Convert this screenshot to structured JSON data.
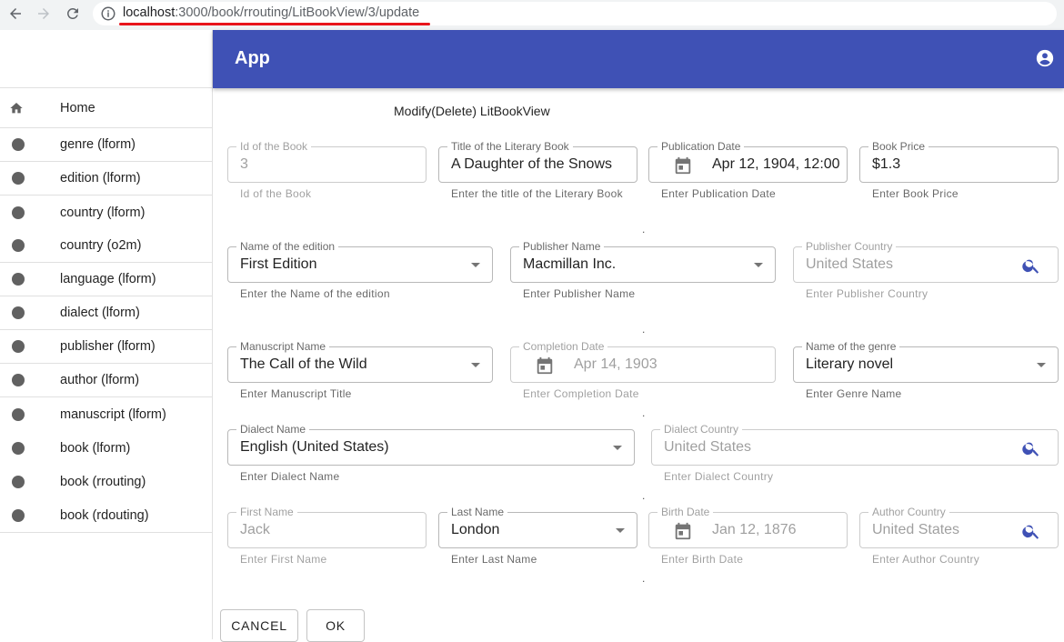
{
  "browser": {
    "url_host": "localhost",
    "url_path": ":3000/book/rrouting/LitBookView/3/update"
  },
  "app": {
    "title": "App"
  },
  "sidebar": {
    "items": [
      {
        "label": "Home",
        "icon": "home-icon"
      },
      {
        "label": "genre (lform)",
        "icon": "dot-icon"
      },
      {
        "label": "edition (lform)",
        "icon": "dot-icon"
      },
      {
        "label": "country (lform)",
        "icon": "dot-icon"
      },
      {
        "label": "country (o2m)",
        "icon": "dot-icon"
      },
      {
        "label": "language (lform)",
        "icon": "dot-icon"
      },
      {
        "label": "dialect (lform)",
        "icon": "dot-icon"
      },
      {
        "label": "publisher (lform)",
        "icon": "dot-icon"
      },
      {
        "label": "author (lform)",
        "icon": "dot-icon"
      },
      {
        "label": "manuscript (lform)",
        "icon": "dot-icon"
      },
      {
        "label": "book (lform)",
        "icon": "dot-icon"
      },
      {
        "label": "book (rrouting)",
        "icon": "dot-icon"
      },
      {
        "label": "book (rdouting)",
        "icon": "dot-icon"
      }
    ]
  },
  "form": {
    "title": "Modify(Delete) LitBookView",
    "separator": ".",
    "fields": {
      "id": {
        "label": "Id of the Book",
        "value": "3",
        "helper": "Id of the Book"
      },
      "title": {
        "label": "Title of the Literary Book",
        "value": "A Daughter of the Snows",
        "helper": "Enter the title of the Literary Book"
      },
      "pub_date": {
        "label": "Publication Date",
        "value": "Apr 12, 1904, 12:00",
        "helper": "Enter Publication Date"
      },
      "price": {
        "label": "Book Price",
        "value": "$1.3",
        "helper": "Enter Book Price"
      },
      "edition": {
        "label": "Name of the edition",
        "value": "First Edition",
        "helper": "Enter the Name of the edition"
      },
      "publisher": {
        "label": "Publisher Name",
        "value": "Macmillan Inc.",
        "helper": "Enter Publisher Name"
      },
      "pub_country": {
        "label": "Publisher Country",
        "value": "United States",
        "helper": "Enter Publisher Country"
      },
      "manuscript": {
        "label": "Manuscript Name",
        "value": "The Call of the Wild",
        "helper": "Enter Manuscript Title"
      },
      "completion": {
        "label": "Completion Date",
        "value": "Apr 14, 1903",
        "helper": "Enter Completion Date"
      },
      "genre": {
        "label": "Name of the genre",
        "value": "Literary novel",
        "helper": "Enter Genre Name"
      },
      "dialect": {
        "label": "Dialect Name",
        "value": "English (United States)",
        "helper": "Enter Dialect Name"
      },
      "dialect_country": {
        "label": "Dialect Country",
        "value": "United States",
        "helper": "Enter Dialect Country"
      },
      "first_name": {
        "label": "First Name",
        "value": "Jack",
        "helper": "Enter First Name"
      },
      "last_name": {
        "label": "Last Name",
        "value": "London",
        "helper": "Enter Last Name"
      },
      "birth_date": {
        "label": "Birth Date",
        "value": "Jan 12, 1876",
        "helper": "Enter Birth Date"
      },
      "author_country": {
        "label": "Author Country",
        "value": "United States",
        "helper": "Enter Author Country"
      }
    },
    "buttons": {
      "cancel": "CANCEL",
      "ok": "OK"
    }
  },
  "colors": {
    "primary": "#3f51b5",
    "search_icon": "#3f51b5",
    "url_underline": "#e8141c"
  }
}
